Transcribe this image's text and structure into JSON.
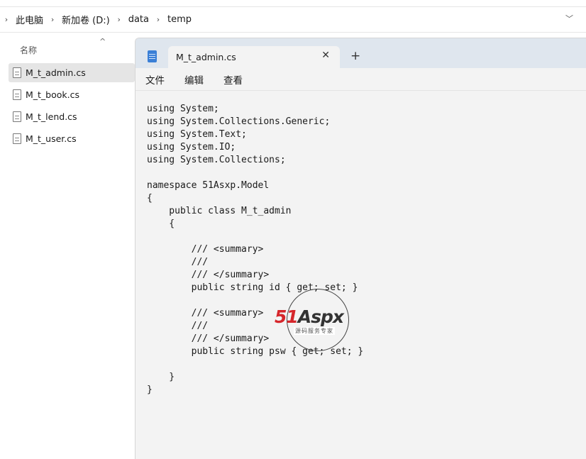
{
  "breadcrumb": {
    "items": [
      "此电脑",
      "新加卷 (D:)",
      "data",
      "temp"
    ]
  },
  "file_list": {
    "column_header": "名称",
    "files": [
      {
        "name": "M_t_admin.cs",
        "selected": true
      },
      {
        "name": "M_t_book.cs",
        "selected": false
      },
      {
        "name": "M_t_lend.cs",
        "selected": false
      },
      {
        "name": "M_t_user.cs",
        "selected": false
      }
    ]
  },
  "notepad": {
    "tab_title": "M_t_admin.cs",
    "close_glyph": "✕",
    "new_tab_glyph": "+",
    "menu": [
      "文件",
      "编辑",
      "查看"
    ],
    "code": "using System;\nusing System.Collections.Generic;\nusing System.Text;\nusing System.IO;\nusing System.Collections;\n\nnamespace 51Asxp.Model\n{\n    public class M_t_admin\n    {\n\n        /// <summary>\n        ///\n        /// </summary>\n        public string id { get; set; }\n\n        /// <summary>\n        ///\n        /// </summary>\n        public string psw { get; set; }\n\n    }\n}"
  },
  "watermark": {
    "brand_part1": "51",
    "brand_part2": "Aspx",
    "tagline": "源码服务专家"
  },
  "colors": {
    "selection": "#e5e5e5",
    "tabstrip": "#dfe6ee",
    "editor_bg": "#f3f3f3",
    "watermark_red": "#d6262b"
  },
  "icons": {
    "breadcrumb_separator": "chevron-right-icon",
    "expand": "chevron-down-icon",
    "sort": "caret-up-icon",
    "file": "document-icon",
    "app": "notepad-icon"
  }
}
